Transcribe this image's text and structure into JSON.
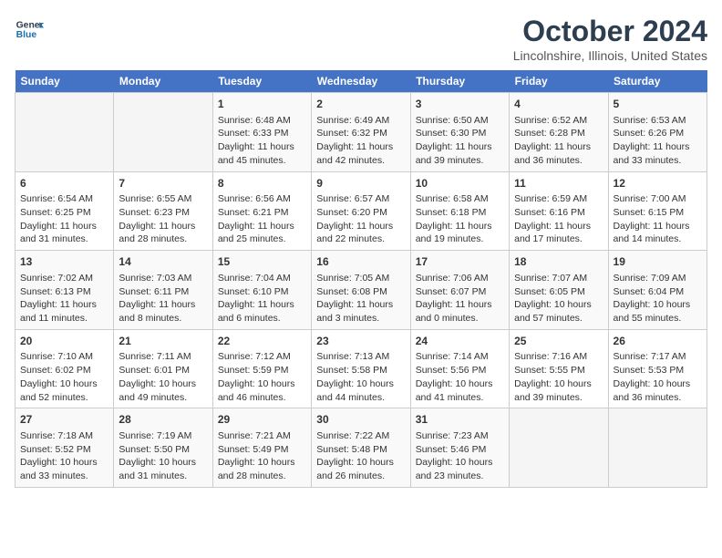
{
  "header": {
    "logo_line1": "General",
    "logo_line2": "Blue",
    "month": "October 2024",
    "location": "Lincolnshire, Illinois, United States"
  },
  "weekdays": [
    "Sunday",
    "Monday",
    "Tuesday",
    "Wednesday",
    "Thursday",
    "Friday",
    "Saturday"
  ],
  "weeks": [
    [
      {
        "day": "",
        "info": ""
      },
      {
        "day": "",
        "info": ""
      },
      {
        "day": "1",
        "info": "Sunrise: 6:48 AM\nSunset: 6:33 PM\nDaylight: 11 hours and 45 minutes."
      },
      {
        "day": "2",
        "info": "Sunrise: 6:49 AM\nSunset: 6:32 PM\nDaylight: 11 hours and 42 minutes."
      },
      {
        "day": "3",
        "info": "Sunrise: 6:50 AM\nSunset: 6:30 PM\nDaylight: 11 hours and 39 minutes."
      },
      {
        "day": "4",
        "info": "Sunrise: 6:52 AM\nSunset: 6:28 PM\nDaylight: 11 hours and 36 minutes."
      },
      {
        "day": "5",
        "info": "Sunrise: 6:53 AM\nSunset: 6:26 PM\nDaylight: 11 hours and 33 minutes."
      }
    ],
    [
      {
        "day": "6",
        "info": "Sunrise: 6:54 AM\nSunset: 6:25 PM\nDaylight: 11 hours and 31 minutes."
      },
      {
        "day": "7",
        "info": "Sunrise: 6:55 AM\nSunset: 6:23 PM\nDaylight: 11 hours and 28 minutes."
      },
      {
        "day": "8",
        "info": "Sunrise: 6:56 AM\nSunset: 6:21 PM\nDaylight: 11 hours and 25 minutes."
      },
      {
        "day": "9",
        "info": "Sunrise: 6:57 AM\nSunset: 6:20 PM\nDaylight: 11 hours and 22 minutes."
      },
      {
        "day": "10",
        "info": "Sunrise: 6:58 AM\nSunset: 6:18 PM\nDaylight: 11 hours and 19 minutes."
      },
      {
        "day": "11",
        "info": "Sunrise: 6:59 AM\nSunset: 6:16 PM\nDaylight: 11 hours and 17 minutes."
      },
      {
        "day": "12",
        "info": "Sunrise: 7:00 AM\nSunset: 6:15 PM\nDaylight: 11 hours and 14 minutes."
      }
    ],
    [
      {
        "day": "13",
        "info": "Sunrise: 7:02 AM\nSunset: 6:13 PM\nDaylight: 11 hours and 11 minutes."
      },
      {
        "day": "14",
        "info": "Sunrise: 7:03 AM\nSunset: 6:11 PM\nDaylight: 11 hours and 8 minutes."
      },
      {
        "day": "15",
        "info": "Sunrise: 7:04 AM\nSunset: 6:10 PM\nDaylight: 11 hours and 6 minutes."
      },
      {
        "day": "16",
        "info": "Sunrise: 7:05 AM\nSunset: 6:08 PM\nDaylight: 11 hours and 3 minutes."
      },
      {
        "day": "17",
        "info": "Sunrise: 7:06 AM\nSunset: 6:07 PM\nDaylight: 11 hours and 0 minutes."
      },
      {
        "day": "18",
        "info": "Sunrise: 7:07 AM\nSunset: 6:05 PM\nDaylight: 10 hours and 57 minutes."
      },
      {
        "day": "19",
        "info": "Sunrise: 7:09 AM\nSunset: 6:04 PM\nDaylight: 10 hours and 55 minutes."
      }
    ],
    [
      {
        "day": "20",
        "info": "Sunrise: 7:10 AM\nSunset: 6:02 PM\nDaylight: 10 hours and 52 minutes."
      },
      {
        "day": "21",
        "info": "Sunrise: 7:11 AM\nSunset: 6:01 PM\nDaylight: 10 hours and 49 minutes."
      },
      {
        "day": "22",
        "info": "Sunrise: 7:12 AM\nSunset: 5:59 PM\nDaylight: 10 hours and 46 minutes."
      },
      {
        "day": "23",
        "info": "Sunrise: 7:13 AM\nSunset: 5:58 PM\nDaylight: 10 hours and 44 minutes."
      },
      {
        "day": "24",
        "info": "Sunrise: 7:14 AM\nSunset: 5:56 PM\nDaylight: 10 hours and 41 minutes."
      },
      {
        "day": "25",
        "info": "Sunrise: 7:16 AM\nSunset: 5:55 PM\nDaylight: 10 hours and 39 minutes."
      },
      {
        "day": "26",
        "info": "Sunrise: 7:17 AM\nSunset: 5:53 PM\nDaylight: 10 hours and 36 minutes."
      }
    ],
    [
      {
        "day": "27",
        "info": "Sunrise: 7:18 AM\nSunset: 5:52 PM\nDaylight: 10 hours and 33 minutes."
      },
      {
        "day": "28",
        "info": "Sunrise: 7:19 AM\nSunset: 5:50 PM\nDaylight: 10 hours and 31 minutes."
      },
      {
        "day": "29",
        "info": "Sunrise: 7:21 AM\nSunset: 5:49 PM\nDaylight: 10 hours and 28 minutes."
      },
      {
        "day": "30",
        "info": "Sunrise: 7:22 AM\nSunset: 5:48 PM\nDaylight: 10 hours and 26 minutes."
      },
      {
        "day": "31",
        "info": "Sunrise: 7:23 AM\nSunset: 5:46 PM\nDaylight: 10 hours and 23 minutes."
      },
      {
        "day": "",
        "info": ""
      },
      {
        "day": "",
        "info": ""
      }
    ]
  ]
}
